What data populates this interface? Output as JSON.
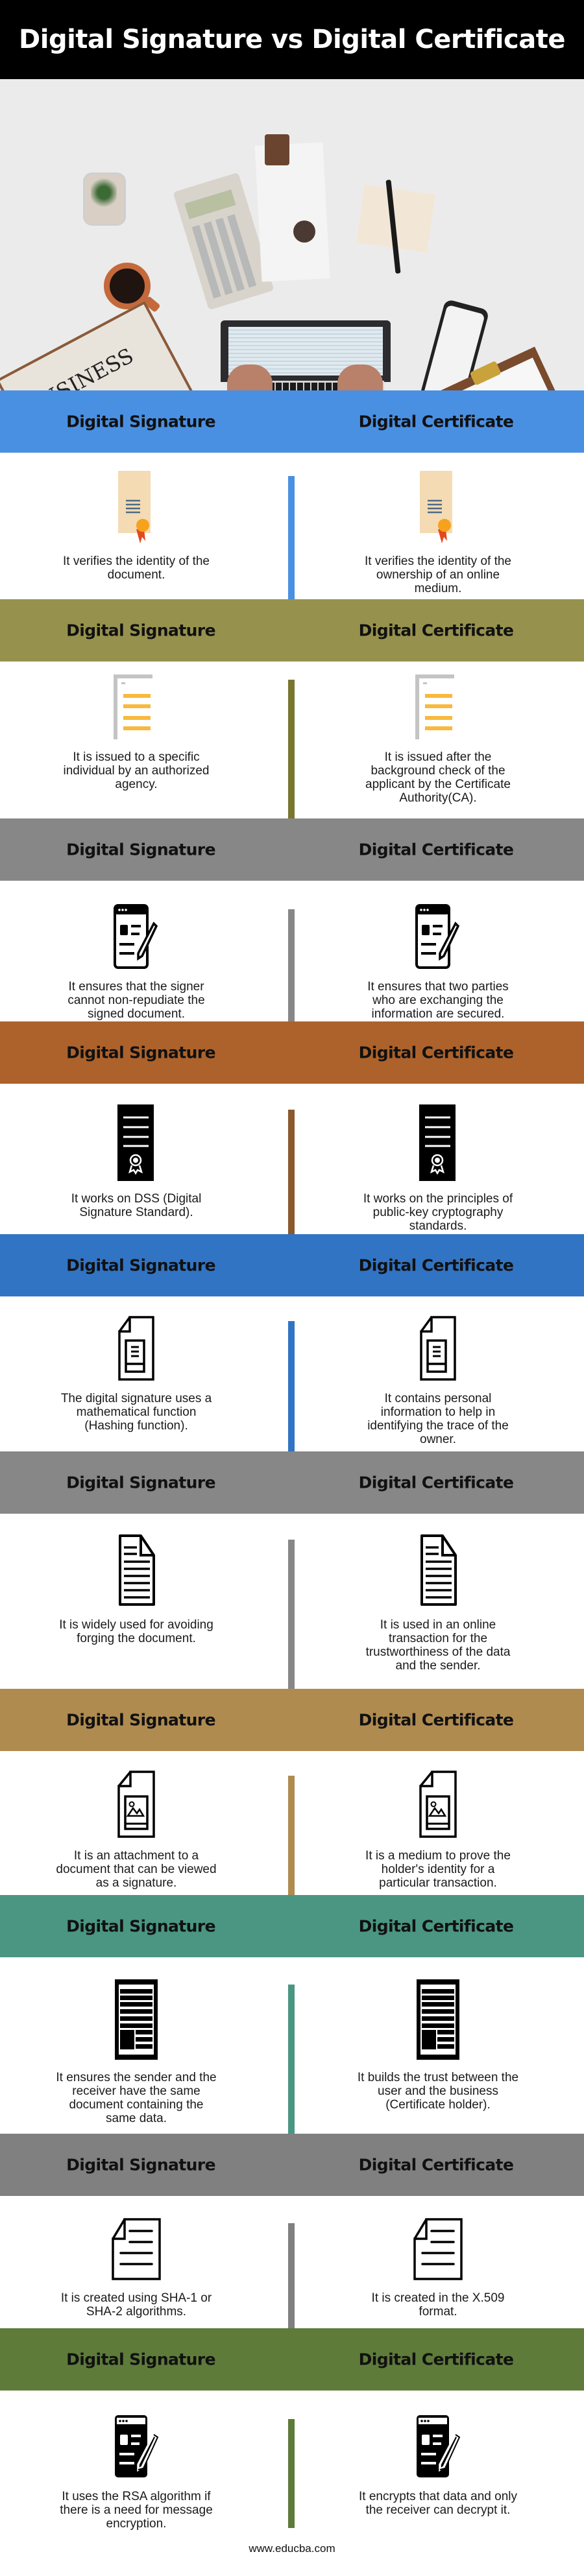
{
  "title": "Digital Signature vs Digital Certificate",
  "photo": {
    "alt": "desk with laptop, calculator, coffee, newspaper labeled BUSINESS, phone and clipboard",
    "newspaper_text": "BUSINESS"
  },
  "column_headers": {
    "left": "Digital Signature",
    "right": "Digital Certificate"
  },
  "sections": [
    {
      "color": "#4a90e2",
      "divider_color": "#4a90e2",
      "icon": "certificate-scroll-icon",
      "left": "It verifies the identity of the document.",
      "right": "It verifies the identity of the ownership of an online medium."
    },
    {
      "color": "#96924e",
      "divider_color": "#7a7630",
      "icon": "list-document-icon",
      "left": "It is issued to a specific individual by an authorized agency.",
      "right": "It is issued after the background check of the applicant by the Certificate Authority(CA)."
    },
    {
      "color": "#878787",
      "divider_color": "#878787",
      "icon": "browser-edit-icon",
      "left": "It ensures that the signer cannot non-repudiate the signed document.",
      "right": "It ensures that two parties who are exchanging the information are secured."
    },
    {
      "color": "#ad622b",
      "divider_color": "#8a5a2e",
      "icon": "certificate-award-icon",
      "left": "It works on DSS (Digital Signature Standard).",
      "right": "It works on the principles of public-key cryptography standards."
    },
    {
      "color": "#3274c4",
      "divider_color": "#3274c4",
      "icon": "file-text-icon",
      "left": "The digital signature uses a mathematical function (Hashing function).",
      "right": "It contains personal information to help in identifying the trace of the owner."
    },
    {
      "color": "#878787",
      "divider_color": "#878787",
      "icon": "document-lines-icon",
      "left": "It is widely used for avoiding forging the document.",
      "right": "It is used in an online transaction for the trustworthiness of the data and the sender."
    },
    {
      "color": "#b08b50",
      "divider_color": "#b08b50",
      "icon": "file-image-icon",
      "left": "It is an attachment to a document that can be viewed as a signature.",
      "right": "It is a medium to prove the holder's identity for a particular transaction."
    },
    {
      "color": "#4a9682",
      "divider_color": "#4a9682",
      "icon": "newspaper-icon",
      "left": "It ensures the sender and the receiver have the same document containing the same data.",
      "right": "It builds the trust between the user and the business (Certificate holder)."
    },
    {
      "color": "#808080",
      "divider_color": "#808080",
      "icon": "page-icon",
      "left": "It is created using SHA-1 or SHA-2 algorithms.",
      "right": "It is created in the X.509 format."
    },
    {
      "color": "#5e7b3a",
      "divider_color": "#5e7b3a",
      "icon": "browser-edit-solid-icon",
      "left": "It uses the RSA algorithm if there is a need for message encryption.",
      "right": "It encrypts that data and only the receiver can decrypt it."
    }
  ],
  "footer": "www.educba.com"
}
